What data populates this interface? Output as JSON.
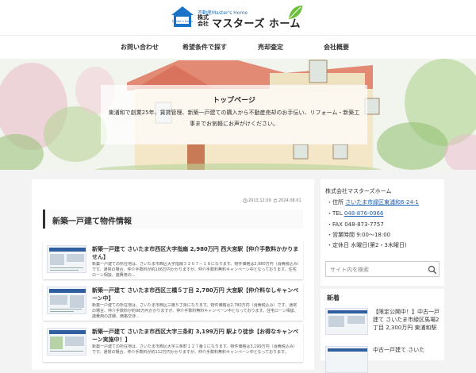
{
  "header": {
    "logo_house_text": "Master's Home",
    "logo_small": "不動産Master's Home",
    "logo_corp": "株式会社",
    "logo_name": "マスターズ ホーム"
  },
  "nav": {
    "items": [
      {
        "label": "お問い合わせ"
      },
      {
        "label": "希望条件で探す"
      },
      {
        "label": "売却査定"
      },
      {
        "label": "会社概要"
      }
    ]
  },
  "hero": {
    "title": "トップページ",
    "description": "東浦和で創業25年、賃貸管理、新築一戸建ての購入から不動産売却のお手伝い、リフォーム・新築工事までお気軽にお声がけください。"
  },
  "main": {
    "published": "2013.12.09",
    "updated": "2024.08.01",
    "heading": "新築一戸建て物件情報",
    "posts": [
      {
        "title": "新築一戸建て さいたま市西区大字指扇 2,980万円 西大宮駅【仲介手数料かかりません】",
        "excerpt": "新築一戸建ての所在地は、さいたま市西区大字指扇３２０７－１８になります。物件価格は2,980万円（消費税込み）です。通常の場合、仲介手数料が約106万円かかりますが、仲介手数料無料キャンペーン中となっております。住宅ローン相談、諸費用の..."
      },
      {
        "title": "新築一戸建て さいたま市西区三橋５丁目 2,780万円 大宮駅【仲介料なしキャンペーン中】",
        "excerpt": "新築一戸建ての所在地は、さいたま市西区三橋５丁目になります。物件価格は2,780万円（消費税込み）です。通常の場合、仲介手数料が約98万円かかりますが、仲介手数料無料キャンペーン中となっております。住宅ローン相談、諸費用の詳細、価格交渉..."
      },
      {
        "title": "新築一戸建て さいたま市西区大字三条町 3,199万円 駅より徒歩【お得なキャンペーン実施中！】",
        "excerpt": "新築一戸建ての所在地は、さいたま市西区大字三条町１２７番１になります。物件価格は3,199万円（消費税込み）です。通常の場合、仲介手数料が約112万円かかりますが、仲介手数料無料キャンペーン中となっております。"
      }
    ]
  },
  "sidebar": {
    "company_title": "株式会社マスターズホーム",
    "address_label": "・住所 ",
    "address_value": "さいたま市緑区東浦和6-24-1",
    "tel_label": "・TEL ",
    "tel_value": "048-876-0966",
    "fax": "・FAX 048-873-7757",
    "hours": "・営業時間 9:00～18:00",
    "holiday": "・定休日 水曜日(第2・3木曜日)",
    "search_placeholder": "サイト内を検索"
  },
  "new_posts": {
    "title": "新着",
    "items": [
      {
        "text": "【限定公開中！】中古一戸建て さいたま市緑区馬場2丁目 2,300万円 東浦和駅"
      },
      {
        "text": "中古一戸建て さいた"
      }
    ]
  },
  "colors": {
    "accent_blue": "#1a5fb4",
    "logo_blue": "#1a73c7",
    "leaf_green": "#6cbf3c"
  }
}
